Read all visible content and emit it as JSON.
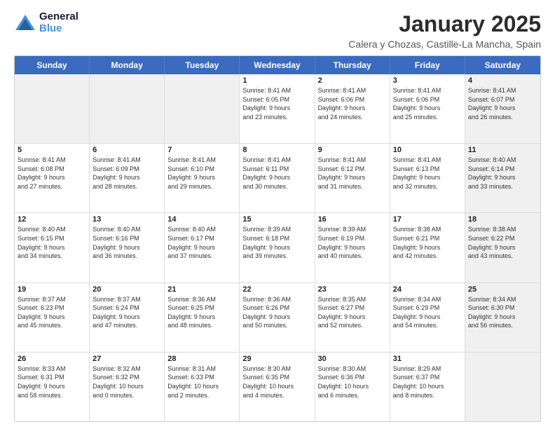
{
  "header": {
    "logo_line1": "General",
    "logo_line2": "Blue",
    "month": "January 2025",
    "location": "Calera y Chozas, Castille-La Mancha, Spain"
  },
  "days_of_week": [
    "Sunday",
    "Monday",
    "Tuesday",
    "Wednesday",
    "Thursday",
    "Friday",
    "Saturday"
  ],
  "weeks": [
    [
      {
        "num": "",
        "info": "",
        "shaded": true
      },
      {
        "num": "",
        "info": "",
        "shaded": true
      },
      {
        "num": "",
        "info": "",
        "shaded": true
      },
      {
        "num": "1",
        "info": "Sunrise: 8:41 AM\nSunset: 6:05 PM\nDaylight: 9 hours\nand 23 minutes."
      },
      {
        "num": "2",
        "info": "Sunrise: 8:41 AM\nSunset: 6:06 PM\nDaylight: 9 hours\nand 24 minutes."
      },
      {
        "num": "3",
        "info": "Sunrise: 8:41 AM\nSunset: 6:06 PM\nDaylight: 9 hours\nand 25 minutes."
      },
      {
        "num": "4",
        "info": "Sunrise: 8:41 AM\nSunset: 6:07 PM\nDaylight: 9 hours\nand 26 minutes.",
        "shaded": true
      }
    ],
    [
      {
        "num": "5",
        "info": "Sunrise: 8:41 AM\nSunset: 6:08 PM\nDaylight: 9 hours\nand 27 minutes."
      },
      {
        "num": "6",
        "info": "Sunrise: 8:41 AM\nSunset: 6:09 PM\nDaylight: 9 hours\nand 28 minutes."
      },
      {
        "num": "7",
        "info": "Sunrise: 8:41 AM\nSunset: 6:10 PM\nDaylight: 9 hours\nand 29 minutes."
      },
      {
        "num": "8",
        "info": "Sunrise: 8:41 AM\nSunset: 6:11 PM\nDaylight: 9 hours\nand 30 minutes."
      },
      {
        "num": "9",
        "info": "Sunrise: 8:41 AM\nSunset: 6:12 PM\nDaylight: 9 hours\nand 31 minutes."
      },
      {
        "num": "10",
        "info": "Sunrise: 8:41 AM\nSunset: 6:13 PM\nDaylight: 9 hours\nand 32 minutes."
      },
      {
        "num": "11",
        "info": "Sunrise: 8:40 AM\nSunset: 6:14 PM\nDaylight: 9 hours\nand 33 minutes.",
        "shaded": true
      }
    ],
    [
      {
        "num": "12",
        "info": "Sunrise: 8:40 AM\nSunset: 6:15 PM\nDaylight: 9 hours\nand 34 minutes."
      },
      {
        "num": "13",
        "info": "Sunrise: 8:40 AM\nSunset: 6:16 PM\nDaylight: 9 hours\nand 36 minutes."
      },
      {
        "num": "14",
        "info": "Sunrise: 8:40 AM\nSunset: 6:17 PM\nDaylight: 9 hours\nand 37 minutes."
      },
      {
        "num": "15",
        "info": "Sunrise: 8:39 AM\nSunset: 6:18 PM\nDaylight: 9 hours\nand 39 minutes."
      },
      {
        "num": "16",
        "info": "Sunrise: 8:39 AM\nSunset: 6:19 PM\nDaylight: 9 hours\nand 40 minutes."
      },
      {
        "num": "17",
        "info": "Sunrise: 8:38 AM\nSunset: 6:21 PM\nDaylight: 9 hours\nand 42 minutes."
      },
      {
        "num": "18",
        "info": "Sunrise: 8:38 AM\nSunset: 6:22 PM\nDaylight: 9 hours\nand 43 minutes.",
        "shaded": true
      }
    ],
    [
      {
        "num": "19",
        "info": "Sunrise: 8:37 AM\nSunset: 6:23 PM\nDaylight: 9 hours\nand 45 minutes."
      },
      {
        "num": "20",
        "info": "Sunrise: 8:37 AM\nSunset: 6:24 PM\nDaylight: 9 hours\nand 47 minutes."
      },
      {
        "num": "21",
        "info": "Sunrise: 8:36 AM\nSunset: 6:25 PM\nDaylight: 9 hours\nand 48 minutes."
      },
      {
        "num": "22",
        "info": "Sunrise: 8:36 AM\nSunset: 6:26 PM\nDaylight: 9 hours\nand 50 minutes."
      },
      {
        "num": "23",
        "info": "Sunrise: 8:35 AM\nSunset: 6:27 PM\nDaylight: 9 hours\nand 52 minutes."
      },
      {
        "num": "24",
        "info": "Sunrise: 8:34 AM\nSunset: 6:29 PM\nDaylight: 9 hours\nand 54 minutes."
      },
      {
        "num": "25",
        "info": "Sunrise: 8:34 AM\nSunset: 6:30 PM\nDaylight: 9 hours\nand 56 minutes.",
        "shaded": true
      }
    ],
    [
      {
        "num": "26",
        "info": "Sunrise: 8:33 AM\nSunset: 6:31 PM\nDaylight: 9 hours\nand 58 minutes."
      },
      {
        "num": "27",
        "info": "Sunrise: 8:32 AM\nSunset: 6:32 PM\nDaylight: 10 hours\nand 0 minutes."
      },
      {
        "num": "28",
        "info": "Sunrise: 8:31 AM\nSunset: 6:33 PM\nDaylight: 10 hours\nand 2 minutes."
      },
      {
        "num": "29",
        "info": "Sunrise: 8:30 AM\nSunset: 6:35 PM\nDaylight: 10 hours\nand 4 minutes."
      },
      {
        "num": "30",
        "info": "Sunrise: 8:30 AM\nSunset: 6:36 PM\nDaylight: 10 hours\nand 6 minutes."
      },
      {
        "num": "31",
        "info": "Sunrise: 8:29 AM\nSunset: 6:37 PM\nDaylight: 10 hours\nand 8 minutes."
      },
      {
        "num": "",
        "info": "",
        "shaded": true
      }
    ]
  ]
}
